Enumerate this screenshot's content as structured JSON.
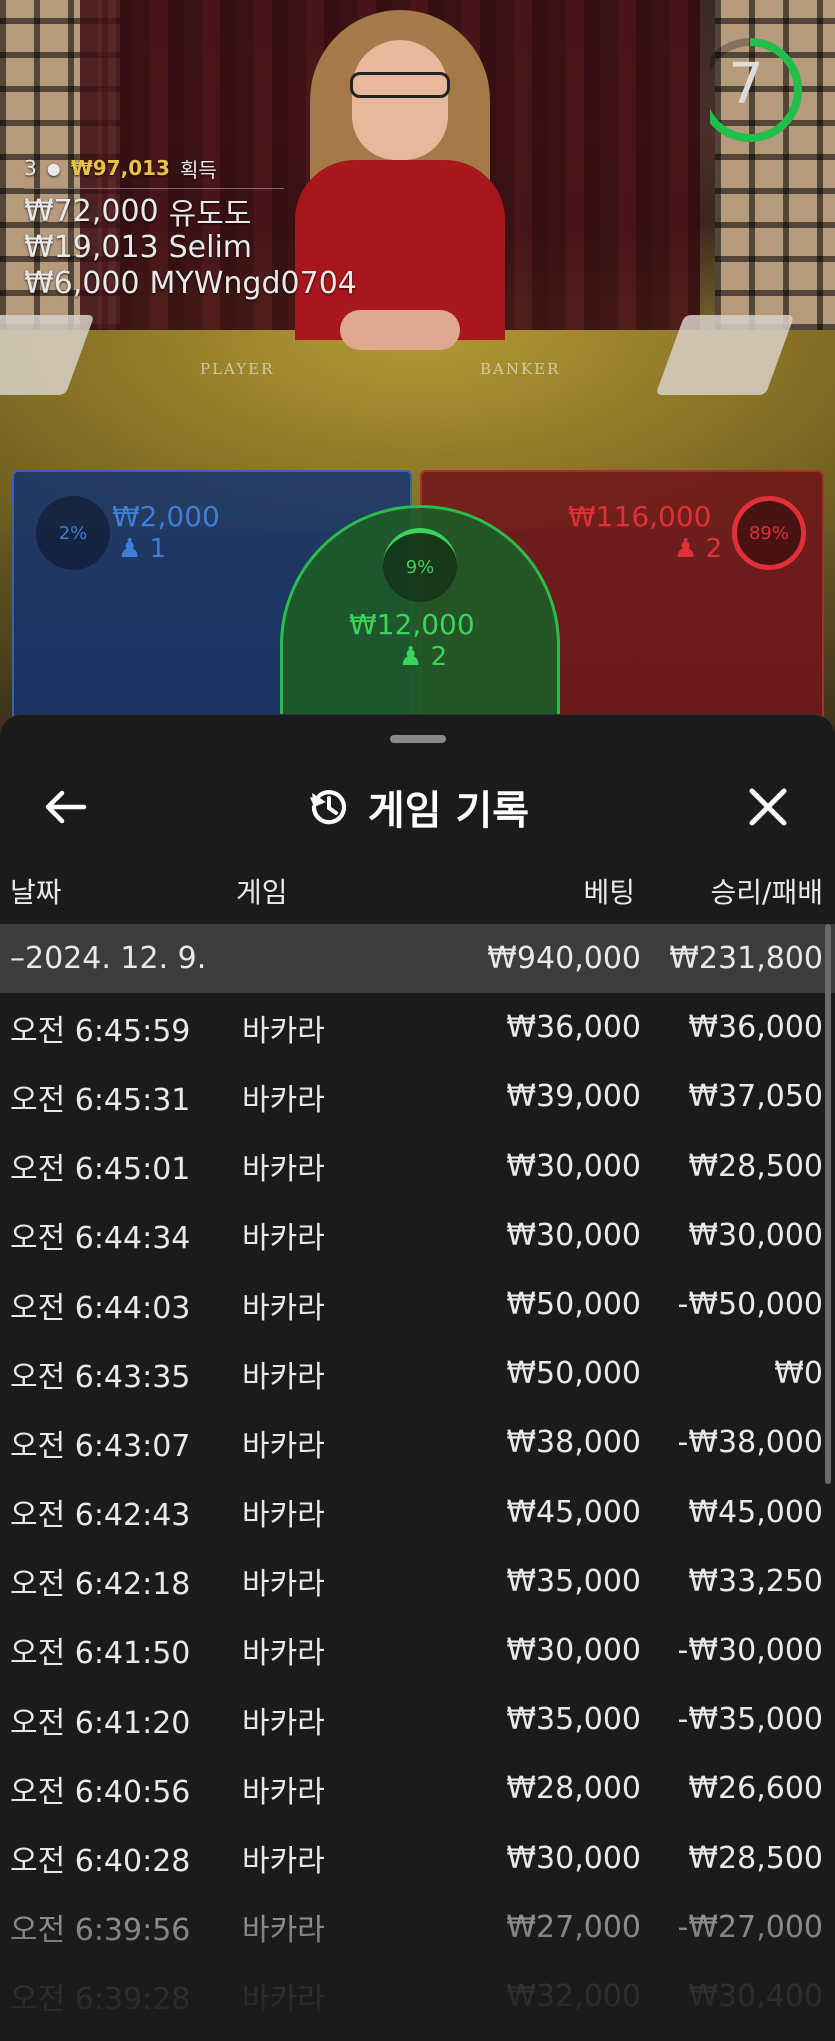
{
  "timer": {
    "seconds": "7",
    "progress": 0.7,
    "color": "#1fbf4a"
  },
  "bet_summary": {
    "players": "3",
    "total_won": "₩97,013",
    "won_label": "획득",
    "winners": [
      {
        "amount": "₩72,000",
        "name": "유도도"
      },
      {
        "amount": "₩19,013",
        "name": "Selim"
      },
      {
        "amount": "₩6,000",
        "name": "MYWngd0704"
      }
    ]
  },
  "felt": {
    "player_text": "PLAYER",
    "banker_text": "BANKER"
  },
  "bets": {
    "player": {
      "percent": "2%",
      "amount": "₩2,000",
      "count": "1",
      "color": "#3f7fd6"
    },
    "tie": {
      "percent": "9%",
      "amount": "₩12,000",
      "count": "2",
      "color": "#39d45a"
    },
    "banker": {
      "percent": "89%",
      "amount": "₩116,000",
      "count": "2",
      "color": "#e0303a"
    }
  },
  "history": {
    "title": "게임 기록",
    "columns": {
      "date": "날짜",
      "game": "게임",
      "bet": "베팅",
      "result": "승리/패배"
    },
    "date_group": {
      "date": "–2024. 12. 9.",
      "bet": "₩940,000",
      "result": "₩231,800"
    },
    "rows": [
      {
        "time": "오전 6:45:59",
        "game": "바카라",
        "bet": "₩36,000",
        "result": "₩36,000"
      },
      {
        "time": "오전 6:45:31",
        "game": "바카라",
        "bet": "₩39,000",
        "result": "₩37,050"
      },
      {
        "time": "오전 6:45:01",
        "game": "바카라",
        "bet": "₩30,000",
        "result": "₩28,500"
      },
      {
        "time": "오전 6:44:34",
        "game": "바카라",
        "bet": "₩30,000",
        "result": "₩30,000"
      },
      {
        "time": "오전 6:44:03",
        "game": "바카라",
        "bet": "₩50,000",
        "result": "-₩50,000"
      },
      {
        "time": "오전 6:43:35",
        "game": "바카라",
        "bet": "₩50,000",
        "result": "₩0"
      },
      {
        "time": "오전 6:43:07",
        "game": "바카라",
        "bet": "₩38,000",
        "result": "-₩38,000"
      },
      {
        "time": "오전 6:42:43",
        "game": "바카라",
        "bet": "₩45,000",
        "result": "₩45,000"
      },
      {
        "time": "오전 6:42:18",
        "game": "바카라",
        "bet": "₩35,000",
        "result": "₩33,250"
      },
      {
        "time": "오전 6:41:50",
        "game": "바카라",
        "bet": "₩30,000",
        "result": "-₩30,000"
      },
      {
        "time": "오전 6:41:20",
        "game": "바카라",
        "bet": "₩35,000",
        "result": "-₩35,000"
      },
      {
        "time": "오전 6:40:56",
        "game": "바카라",
        "bet": "₩28,000",
        "result": "₩26,600"
      },
      {
        "time": "오전 6:40:28",
        "game": "바카라",
        "bet": "₩30,000",
        "result": "₩28,500"
      },
      {
        "time": "오전 6:39:56",
        "game": "바카라",
        "bet": "₩27,000",
        "result": "-₩27,000"
      },
      {
        "time": "오전 6:39:28",
        "game": "바카라",
        "bet": "₩32,000",
        "result": "₩30,400"
      }
    ]
  }
}
